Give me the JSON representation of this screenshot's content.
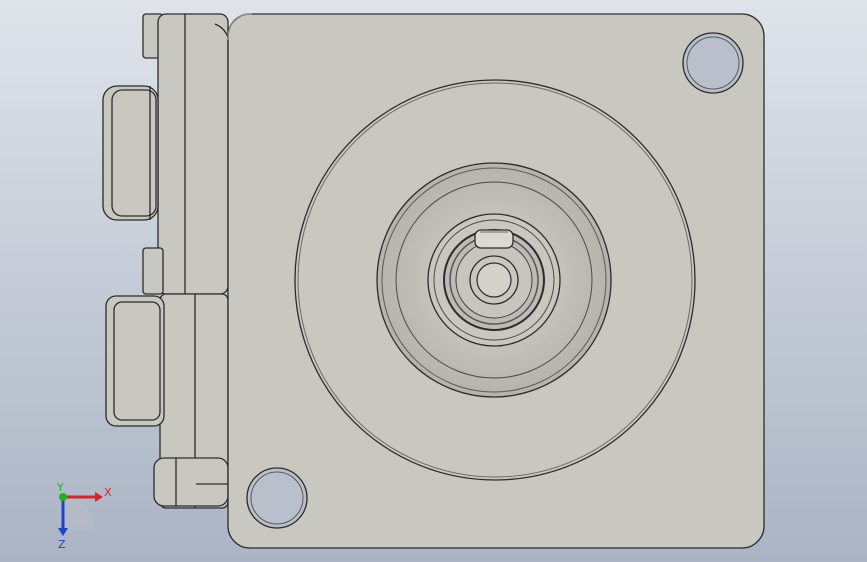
{
  "viewport": {
    "background_top": "#dfe4ea",
    "background_bottom": "#aab4c4",
    "part_fill": "#c8c8c0",
    "part_shadow": "#a8a8a0",
    "edge_color": "#2b2b2b",
    "hole_fill": "#b9c0cb"
  },
  "triad": {
    "x_label": "X",
    "y_label": "Y",
    "z_label": "Z",
    "x_color": "#e02020",
    "y_color": "#20b020",
    "z_color": "#2040d0"
  }
}
